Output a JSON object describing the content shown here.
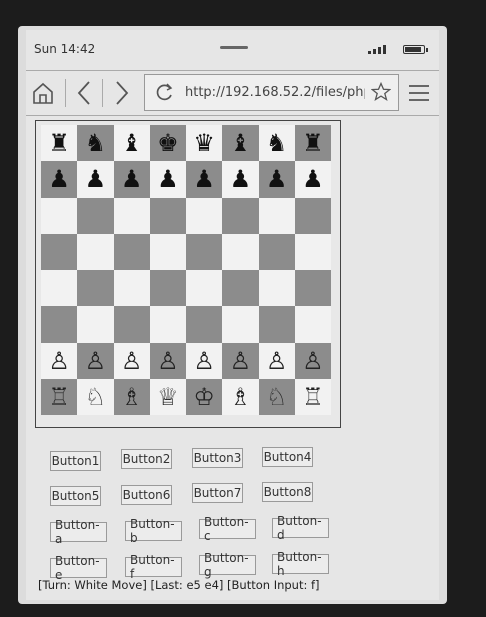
{
  "status_bar": {
    "time": "Sun 14:42"
  },
  "browser": {
    "url": "http://192.168.52.2/files/php-"
  },
  "board": {
    "rows": [
      [
        "♜",
        "♞",
        "♝",
        "♚",
        "♛",
        "♝",
        "♞",
        "♜"
      ],
      [
        "♟",
        "♟",
        "♟",
        "♟",
        "♟",
        "♟",
        "♟",
        "♟"
      ],
      [
        "",
        "",
        "",
        "",
        "",
        "",
        "",
        ""
      ],
      [
        "",
        "",
        "",
        "",
        "",
        "",
        "",
        ""
      ],
      [
        "",
        "",
        "",
        "",
        "",
        "",
        "",
        ""
      ],
      [
        "",
        "",
        "",
        "",
        "",
        "",
        "",
        ""
      ],
      [
        "♙",
        "♙",
        "♙",
        "♙",
        "♙",
        "♙",
        "♙",
        "♙"
      ],
      [
        "♖",
        "♘",
        "♗",
        "♕",
        "♔",
        "♗",
        "♘",
        "♖"
      ]
    ]
  },
  "buttons": {
    "b1": "Button1",
    "b2": "Button2",
    "b3": "Button3",
    "b4": "Button4",
    "b5": "Button5",
    "b6": "Button6",
    "b7": "Button7",
    "b8": "Button8",
    "ba": "Button-a",
    "bb": "Button-b",
    "bc": "Button-c",
    "bd": "Button-d",
    "be": "Button-e",
    "bf": "Button-f",
    "bg": "Button-g",
    "bh": "Button-h"
  },
  "status_line": "[Turn: White Move] [Last: e5 e4] [Button Input: f]"
}
